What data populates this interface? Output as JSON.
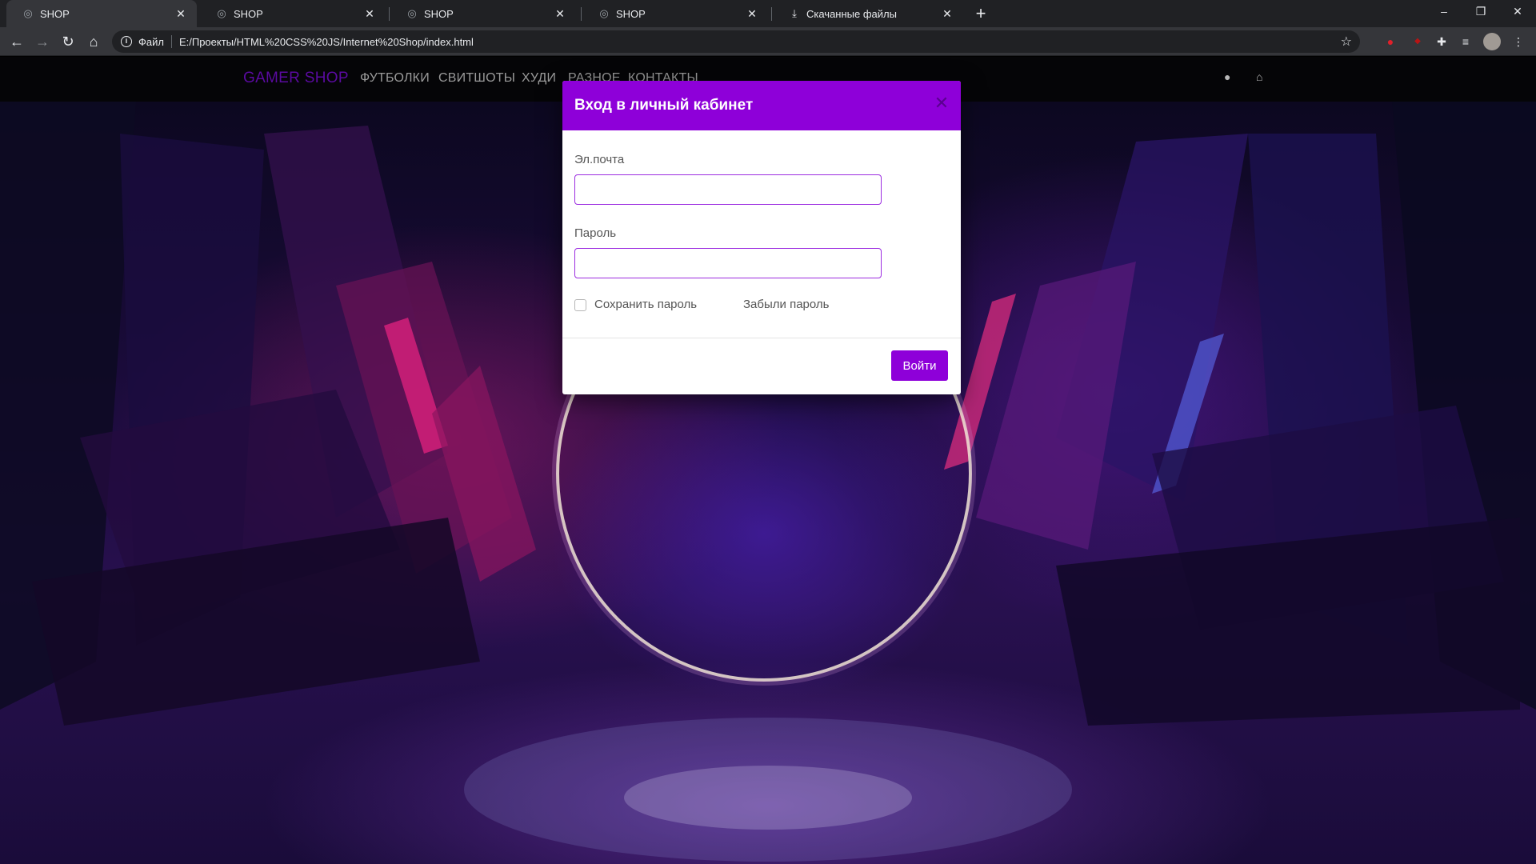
{
  "browser": {
    "tabs": [
      {
        "title": "SHOP",
        "icon": "globe-icon",
        "active": true
      },
      {
        "title": "SHOP",
        "icon": "globe-icon",
        "active": false
      },
      {
        "title": "SHOP",
        "icon": "globe-icon",
        "active": false
      },
      {
        "title": "SHOP",
        "icon": "globe-icon",
        "active": false
      },
      {
        "title": "Скачанные файлы",
        "icon": "download-icon",
        "active": false
      }
    ],
    "address": {
      "scheme_label": "Файл",
      "url": "E:/Проекты/HTML%20CSS%20JS/Internet%20Shop/index.html"
    }
  },
  "site": {
    "brand": "GAMER SHOP",
    "nav": [
      "ФУТБОЛКИ",
      "СВИТШОТЫ",
      "ХУДИ",
      "РАЗНОЕ",
      "КОНТАКТЫ"
    ],
    "icons": [
      "user-icon",
      "basket-icon"
    ]
  },
  "modal": {
    "title": "Вход в личный кабинет",
    "email_label": "Эл.почта",
    "email_value": "",
    "password_label": "Пароль",
    "password_value": "",
    "remember_label": "Сохранить пароль",
    "remember_checked": false,
    "forgot_label": "Забыли пароль",
    "submit_label": "Войти"
  },
  "colors": {
    "accent": "#8e00d9",
    "brand_text": "#5a0aa0",
    "nav_background": "#050507"
  }
}
